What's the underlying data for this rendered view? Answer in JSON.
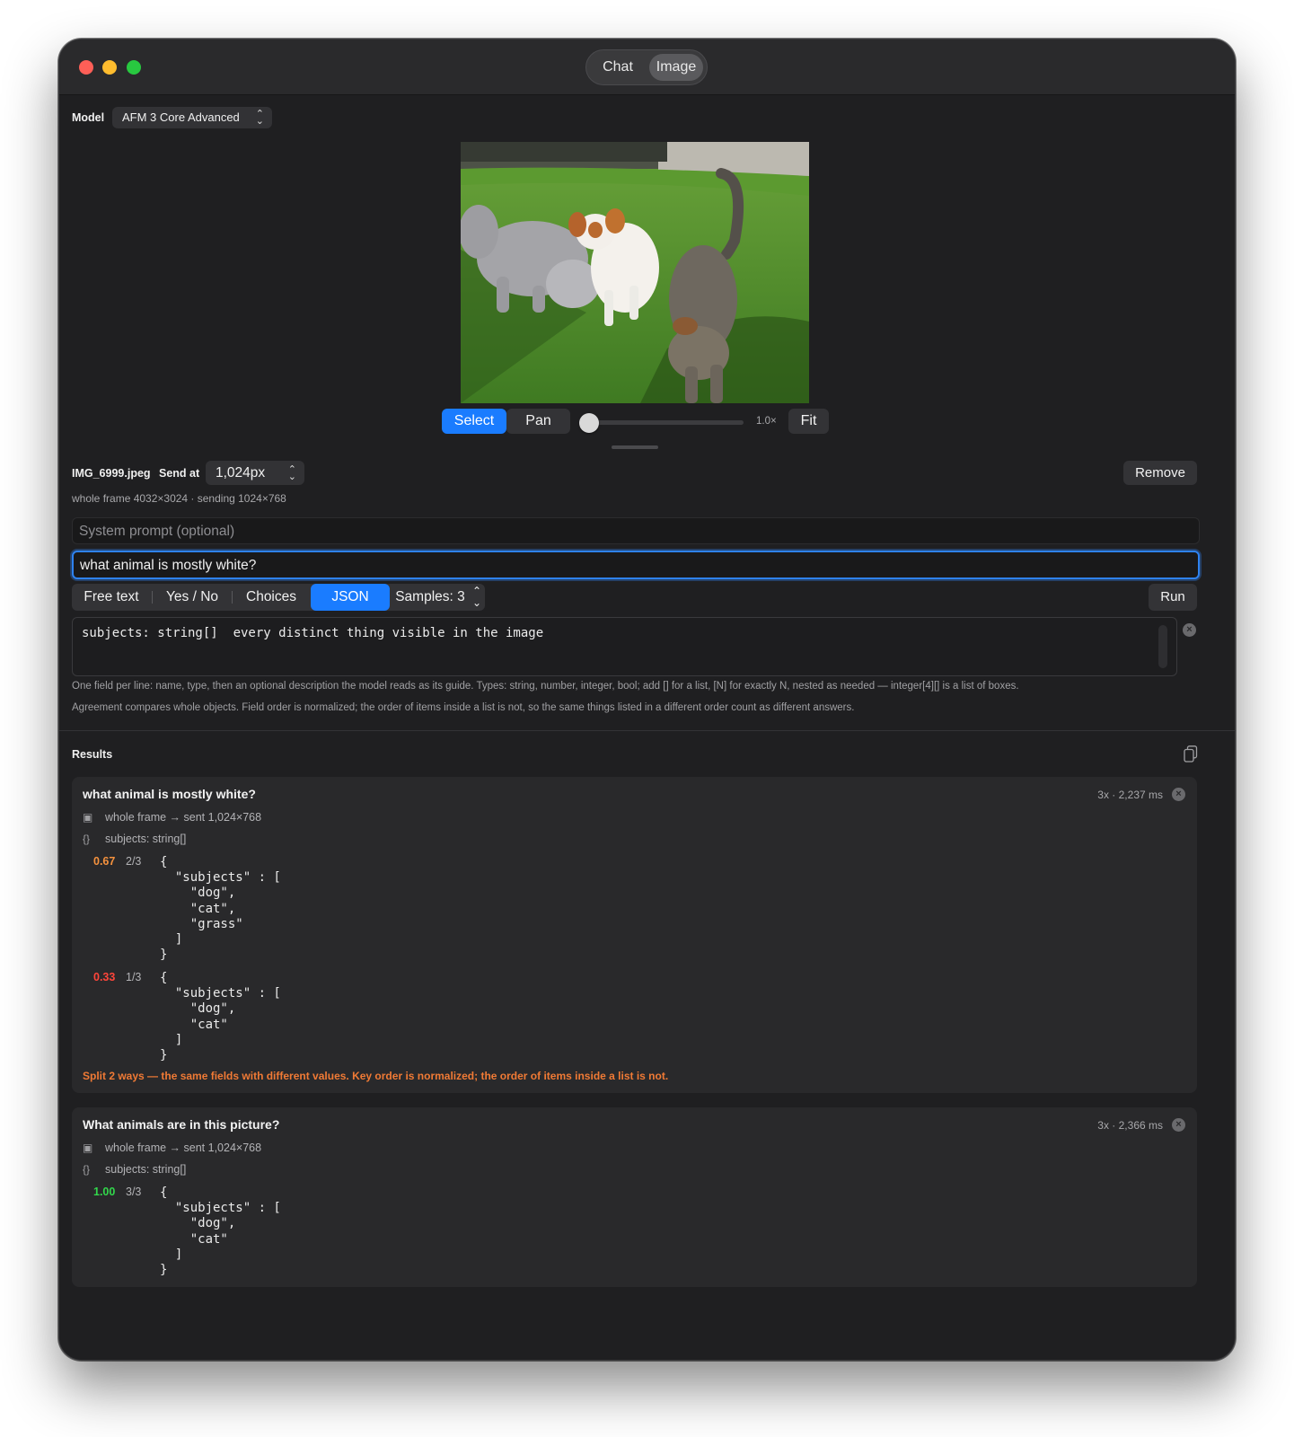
{
  "window": {
    "segments": [
      "Chat",
      "Image"
    ],
    "active_segment": "Image"
  },
  "model": {
    "label": "Model",
    "value": "AFM 3 Core Advanced"
  },
  "viewer": {
    "select_label": "Select",
    "pan_label": "Pan",
    "zoom_value": 0.0,
    "zoom_label": "1.0×",
    "fit_label": "Fit"
  },
  "image_info": {
    "filename": "IMG_6999.jpeg",
    "send_at_label": "Send at",
    "send_at_value": "1,024px",
    "details": "whole frame 4032×3024 · sending 1024×768",
    "remove_label": "Remove"
  },
  "inputs": {
    "system_placeholder": "System prompt (optional)",
    "prompt_value": "what animal is mostly white?"
  },
  "modes": {
    "items": [
      "Free text",
      "Yes / No",
      "Choices",
      "JSON"
    ],
    "active": "JSON",
    "samples_label": "Samples: 3",
    "run_label": "Run"
  },
  "schema": {
    "text": "subjects: string[]  every distinct thing visible in the image",
    "help1": "One field per line: name, type, then an optional description the model reads as its guide. Types: string, number, integer, bool; add [] for a list, [N] for exactly N, nested as needed — integer[4][] is a list of boxes.",
    "help2": "Agreement compares whole objects. Field order is normalized; the order of items inside a list is not, so the same things listed in a different order count as different answers."
  },
  "results": {
    "title": "Results",
    "cards": [
      {
        "question": "what animal is mostly white?",
        "meta": "3x · 2,237 ms",
        "frame": "whole frame → sent 1,024×768",
        "schema": "subjects: string[]",
        "answers": [
          {
            "score": "0.67",
            "fraction": "2/3",
            "color": "#f5923e",
            "json": "{\n  \"subjects\" : [\n    \"dog\",\n    \"cat\",\n    \"grass\"\n  ]\n}"
          },
          {
            "score": "0.33",
            "fraction": "1/3",
            "color": "#ff453a",
            "json": "{\n  \"subjects\" : [\n    \"dog\",\n    \"cat\"\n  ]\n}"
          }
        ],
        "warning": "Split 2 ways — the same fields with different values. Key order is normalized; the order of items inside a list is not."
      },
      {
        "question": "What animals are in this picture?",
        "meta": "3x · 2,366 ms",
        "frame": "whole frame → sent 1,024×768",
        "schema": "subjects: string[]",
        "answers": [
          {
            "score": "1.00",
            "fraction": "3/3",
            "color": "#32d74b",
            "json": "{\n  \"subjects\" : [\n    \"dog\",\n    \"cat\"\n  ]\n}"
          }
        ]
      }
    ]
  },
  "icons": {
    "image": "photo-icon",
    "schema": "braces-icon",
    "copy": "copy-icon",
    "close": "close-circle-icon"
  },
  "colors": {
    "accent": "#1a7cff",
    "warning": "#f07a35"
  }
}
